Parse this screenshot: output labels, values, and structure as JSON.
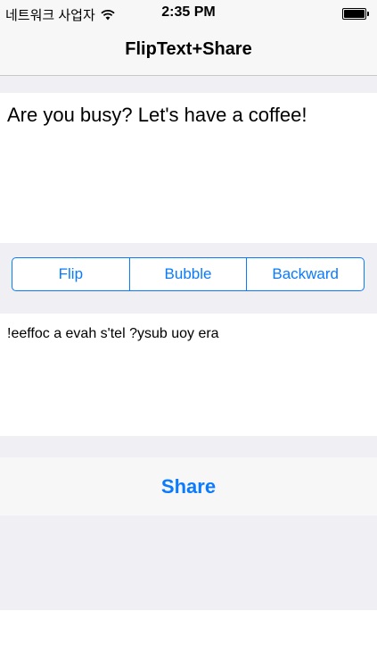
{
  "status_bar": {
    "carrier": "네트워크 사업자",
    "time": "2:35 PM",
    "wifi_icon": "wifi-icon",
    "battery_icon": "battery-icon",
    "battery_level": 1.0
  },
  "nav": {
    "title": "FlipText+Share"
  },
  "input": {
    "value": "Are you busy? Let's have a coffee!"
  },
  "modes": {
    "items": [
      {
        "label": "Flip"
      },
      {
        "label": "Bubble"
      },
      {
        "label": "Backward"
      }
    ]
  },
  "output": {
    "value": "!eeffoc a evah s'tel ?ysub uoy era"
  },
  "share": {
    "label": "Share"
  },
  "colors": {
    "accent": "#0a7aff",
    "grouped_background": "#efeff4",
    "bar_background": "#f7f7f7"
  }
}
